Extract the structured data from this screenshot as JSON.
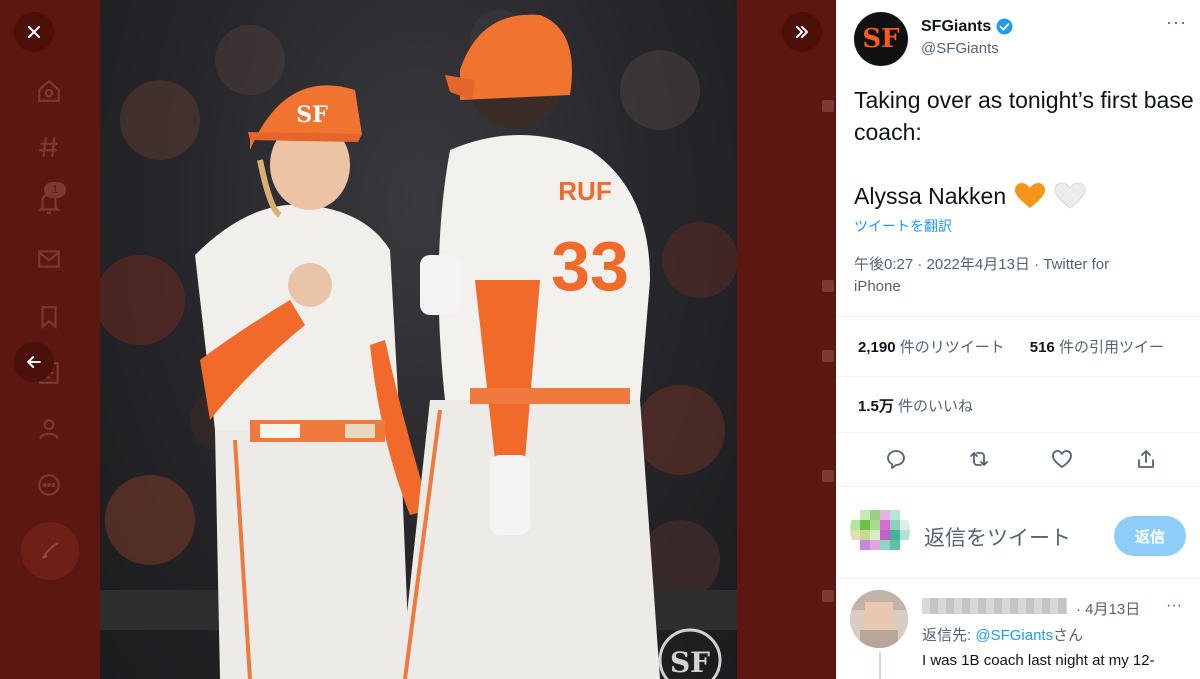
{
  "viewer": {
    "close_label": "×",
    "nav_badge": "1"
  },
  "tweet": {
    "display_name": "SFGiants",
    "handle": "@SFGiants",
    "avatar_glyph": "SF",
    "more": "···",
    "text_line1": "Taking over as tonight’s first base coach:",
    "text_line2": "Alyssa Nakken",
    "translate": "ツイートを翻訳",
    "meta": "午後0:27 · 2022年4月13日 · Twitter for iPhone",
    "retweets_count": "2,190",
    "retweets_label": "件のリツイート",
    "quotes_count": "516",
    "quotes_label": "件の引用ツイー",
    "likes_count": "1.5万",
    "likes_label": "件のいいね",
    "brand_color": "#fd5a1e",
    "link_color": "#1d9bf0"
  },
  "reply_box": {
    "placeholder": "返信をツイート",
    "button": "返信"
  },
  "reply": {
    "date": "· 4月13日",
    "more": "···",
    "reply_to_prefix": "返信先: ",
    "reply_to_handle": "@SFGiants",
    "reply_to_suffix": "さん",
    "text": "I was 1B coach last night at my 12-"
  },
  "photo": {
    "jersey_number": "33",
    "nameplate": "RUF"
  }
}
